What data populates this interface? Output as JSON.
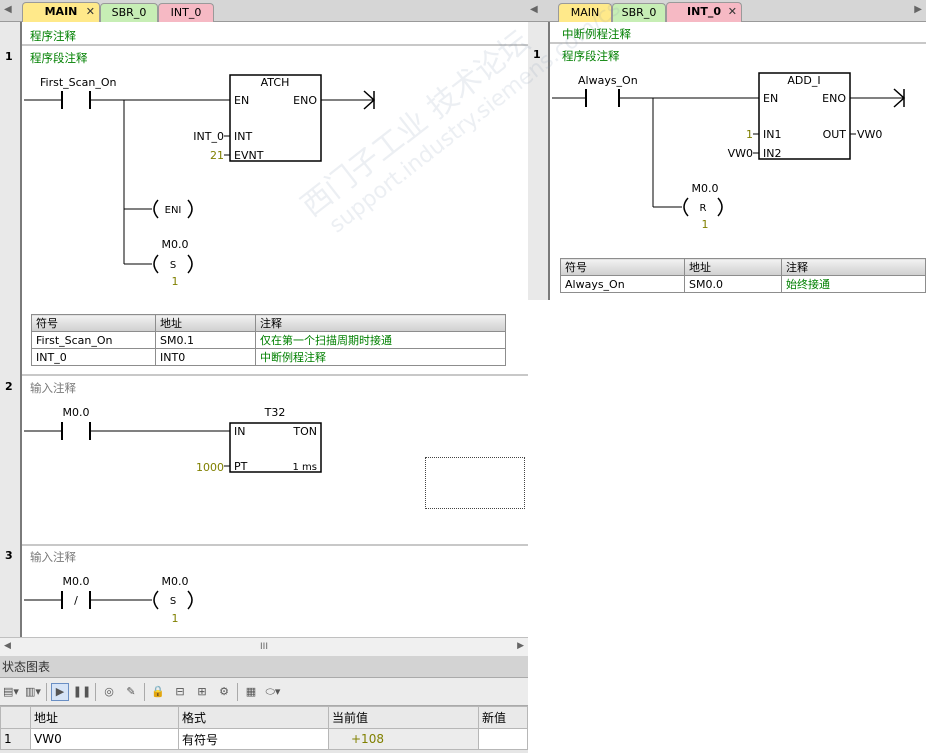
{
  "left_editor": {
    "tabs": [
      {
        "label": "MAIN",
        "active": true,
        "closable": true
      },
      {
        "label": "SBR_0",
        "active": false
      },
      {
        "label": "INT_0",
        "active": false
      }
    ],
    "program_comment": "程序注释",
    "networks": [
      {
        "number": "1",
        "comment": "程序段注释",
        "contact_name": "First_Scan_On",
        "box_title": "ATCH",
        "box_en": "EN",
        "box_eno": "ENO",
        "param1_value": "INT_0",
        "param1_pin": "INT",
        "param2_value": "21",
        "param2_pin": "EVNT",
        "coil1_label": "ENI",
        "coil2_address": "M0.0",
        "coil2_label": "S",
        "coil2_count": "1",
        "symbol_table": {
          "headers": [
            "符号",
            "地址",
            "注释"
          ],
          "rows": [
            [
              "First_Scan_On",
              "SM0.1",
              "仅在第一个扫描周期时接通"
            ],
            [
              "INT_0",
              "INT0",
              "中断例程注释"
            ]
          ]
        }
      },
      {
        "number": "2",
        "comment": "输入注释",
        "contact_address": "M0.0",
        "timer_name": "T32",
        "box_in": "IN",
        "box_type": "TON",
        "preset_value": "1000",
        "preset_pin": "PT",
        "time_base": "1 ms"
      },
      {
        "number": "3",
        "comment": "输入注释",
        "contact_address": "M0.0",
        "contact_symbol": "/",
        "coil_address": "M0.0",
        "coil_label": "S",
        "coil_count": "1"
      }
    ],
    "scrollbar_grip": "III"
  },
  "right_editor": {
    "tabs": [
      {
        "label": "MAIN",
        "active": false
      },
      {
        "label": "SBR_0",
        "active": false
      },
      {
        "label": "INT_0",
        "active": true,
        "closable": true
      }
    ],
    "program_comment": "中断例程注释",
    "networks": [
      {
        "number": "1",
        "comment": "程序段注释",
        "contact_name": "Always_On",
        "box_title": "ADD_I",
        "box_en": "EN",
        "box_eno": "ENO",
        "in1_value": "1",
        "in1_pin": "IN1",
        "in2_value": "VW0",
        "in2_pin": "IN2",
        "out_pin": "OUT",
        "out_value": "VW0",
        "coil_address": "M0.0",
        "coil_label": "R",
        "coil_count": "1",
        "symbol_table": {
          "headers": [
            "符号",
            "地址",
            "注释"
          ],
          "rows": [
            [
              "Always_On",
              "SM0.0",
              "始终接通"
            ]
          ]
        }
      }
    ]
  },
  "status_chart": {
    "title": "状态图表",
    "headers": [
      "",
      "地址",
      "格式",
      "当前值",
      "新值"
    ],
    "rows": [
      {
        "num": "1",
        "address": "VW0",
        "format": "有符号",
        "current": "+108",
        "new": ""
      }
    ]
  },
  "watermark": {
    "line1": "西门子工业 技术论坛",
    "line2": "support.industry.siemens.com/cs"
  },
  "colors": {
    "comment_green": "#008000",
    "tab_main": "#ffe98a",
    "tab_sbr": "#c7eeb5",
    "tab_int": "#f6b9c4",
    "value_olive": "#808000"
  }
}
